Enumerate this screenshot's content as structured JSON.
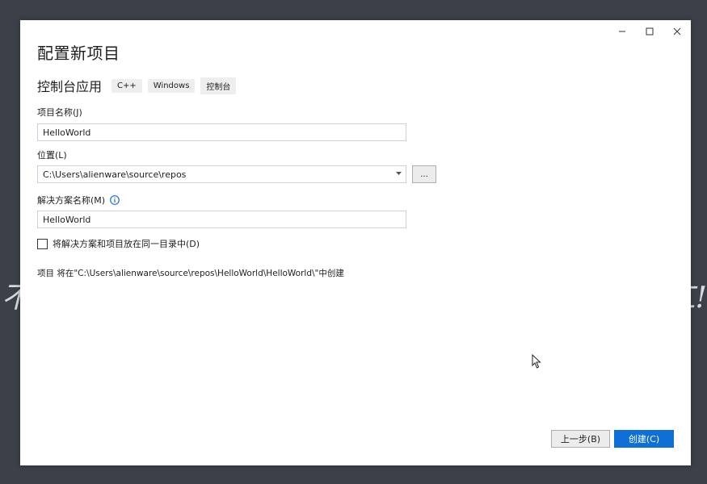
{
  "window": {
    "title": "配置新项目",
    "controls": [
      "minimize-icon",
      "maximize-icon",
      "close-icon"
    ]
  },
  "template": {
    "name": "控制台应用",
    "tags": [
      "C++",
      "Windows",
      "控制台"
    ]
  },
  "project_name": {
    "label": "项目名称(J)",
    "value": "HelloWorld"
  },
  "location": {
    "label": "位置(L)",
    "value": "C:\\Users\\alienware\\source\\repos",
    "browse_label": "..."
  },
  "solution_name": {
    "label": "解决方案名称(M)",
    "value": "HelloWorld"
  },
  "same_directory": {
    "label": "将解决方案和项目放在同一目录中(D)",
    "checked": false
  },
  "path_note": "项目 将在\"C:\\Users\\alienware\\source\\repos\\HelloWorld\\HelloWorld\\\"中创建",
  "buttons": {
    "back_label": "上一步(B)",
    "create_label": "创建(C)"
  },
  "colors": {
    "accent": "#0e6fd6",
    "background": "#3c4149",
    "info_icon": "#1a6fd1"
  }
}
